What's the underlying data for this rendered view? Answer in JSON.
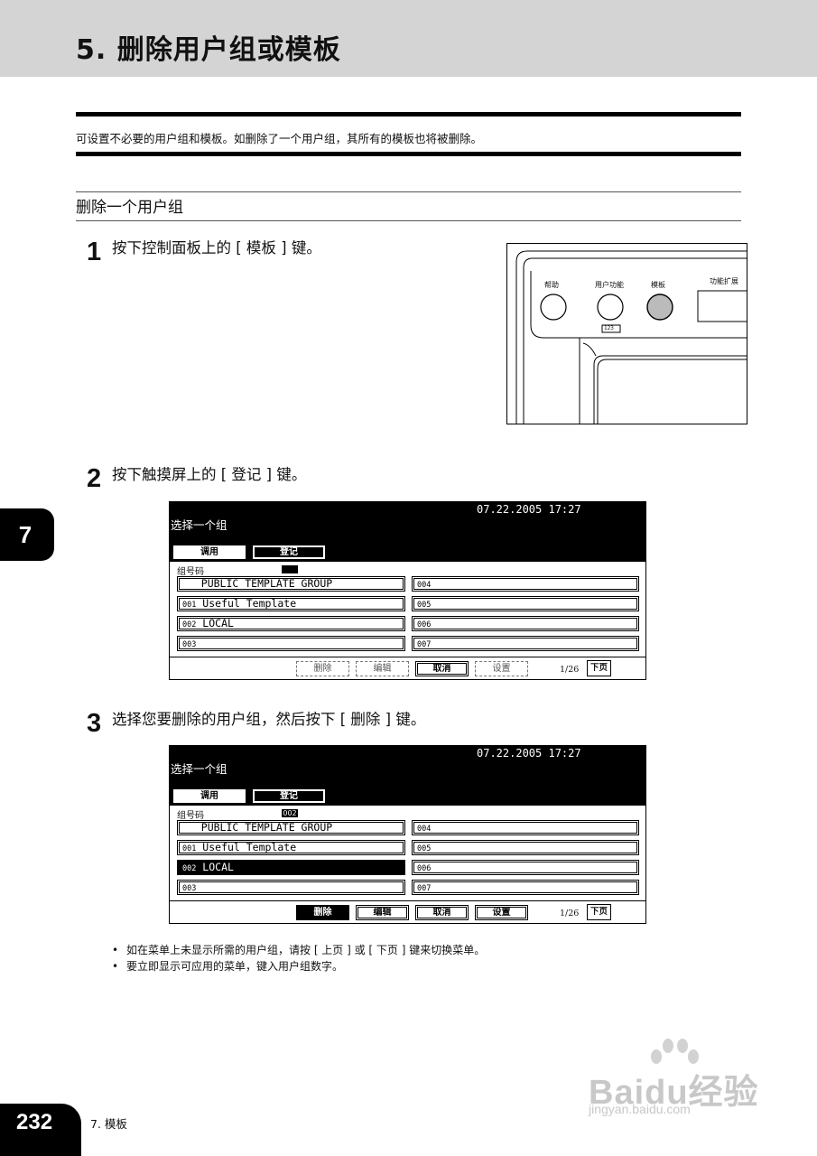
{
  "header": {
    "title": "5. 删除用户组或模板"
  },
  "intro": "可设置不必要的用户组和模板。如删除了一个用户组，其所有的模板也将被删除。",
  "section_title": "删除一个用户组",
  "steps": [
    {
      "num": "1",
      "text": "按下控制面板上的 [ 模板 ] 键。"
    },
    {
      "num": "2",
      "text": "按下触摸屏上的 [ 登记 ] 键。"
    },
    {
      "num": "3",
      "text": "选择您要删除的用户组，然后按下 [ 删除 ] 键。"
    }
  ],
  "control_panel": {
    "btn_help": "帮助",
    "btn_user_func": "用户功能",
    "btn_user_func_sub": "123",
    "btn_template": "模板",
    "btn_ext": "功能扩展"
  },
  "screen1": {
    "datetime": "07.22.2005 17:27",
    "title": "选择一个组",
    "tab_recall": "调用",
    "tab_register": "登记",
    "group_code_label": "组号码",
    "group_code": "",
    "rows_left": [
      {
        "code": "",
        "name": "PUBLIC TEMPLATE GROUP"
      },
      {
        "code": "001",
        "name": "Useful Template"
      },
      {
        "code": "002",
        "name": "LOCAL"
      },
      {
        "code": "003",
        "name": ""
      }
    ],
    "rows_right": [
      "004",
      "005",
      "006",
      "007"
    ],
    "btn_delete": "删除",
    "btn_edit": "编辑",
    "btn_cancel": "取消",
    "btn_set": "设置",
    "page": "1/26",
    "btn_next": "下页"
  },
  "screen2": {
    "datetime": "07.22.2005 17:27",
    "title": "选择一个组",
    "tab_recall": "调用",
    "tab_register": "登记",
    "group_code_label": "组号码",
    "group_code": "002",
    "rows_left": [
      {
        "code": "",
        "name": "PUBLIC TEMPLATE GROUP"
      },
      {
        "code": "001",
        "name": "Useful Template"
      },
      {
        "code": "002",
        "name": "LOCAL"
      },
      {
        "code": "003",
        "name": ""
      }
    ],
    "rows_right": [
      "004",
      "005",
      "006",
      "007"
    ],
    "btn_delete": "删除",
    "btn_edit": "编辑",
    "btn_cancel": "取消",
    "btn_set": "设置",
    "page": "1/26",
    "btn_next": "下页"
  },
  "notes": [
    "如在菜单上未显示所需的用户组，请按 [ 上页 ] 或 [ 下页 ] 键来切换菜单。",
    "要立即显示可应用的菜单，键入用户组数字。"
  ],
  "side_tab": "7",
  "footer": {
    "page_number": "232",
    "chapter": "7. 模板"
  },
  "watermark": {
    "brand": "Baidu经验",
    "url": "jingyan.baidu.com"
  }
}
